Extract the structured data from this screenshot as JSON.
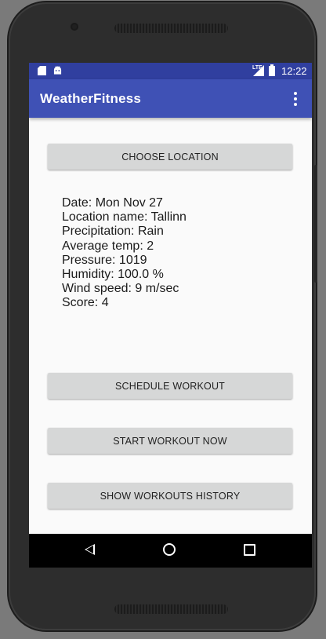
{
  "status_bar": {
    "time": "12:22",
    "network": "LTE",
    "icons": [
      "sd-card-icon",
      "android-icon",
      "signal-icon",
      "battery-charging-icon"
    ]
  },
  "app_bar": {
    "title": "WeatherFitness",
    "menu_icon": "overflow-menu-icon"
  },
  "buttons": {
    "choose_location": "CHOOSE LOCATION",
    "schedule_workout": "SCHEDULE WORKOUT",
    "start_workout": "START WORKOUT NOW",
    "show_history": "SHOW WORKOUTS HISTORY"
  },
  "weather": {
    "date": "Date: Mon Nov 27",
    "location": "Location name: Tallinn",
    "precipitation": "Precipitation: Rain",
    "avg_temp": "Average temp: 2",
    "pressure": "Pressure: 1019",
    "humidity": "Humidity: 100.0 %",
    "wind_speed": "Wind speed: 9 m/sec",
    "score": "Score: 4"
  },
  "nav_bar": {
    "icons": [
      "back-icon",
      "home-icon",
      "recents-icon"
    ]
  },
  "colors": {
    "status_bar": "#303f9f",
    "app_bar": "#3f51b5",
    "button": "#d6d7d7",
    "background": "#fafafa"
  }
}
